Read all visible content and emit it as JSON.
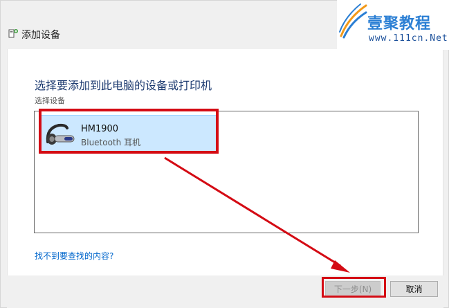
{
  "window": {
    "title": "添加设备",
    "title_icon": "add-device-icon"
  },
  "watermark": {
    "brand_cn": "壹聚教程",
    "url": "www.111cn.Net"
  },
  "main": {
    "heading": "选择要添加到此电脑的设备或打印机",
    "sublabel": "选择设备",
    "devices": [
      {
        "name": "HM1900",
        "type": "Bluetooth 耳机",
        "icon": "bluetooth-headset-icon",
        "selected": true
      }
    ],
    "help_link": "找不到要查找的内容?"
  },
  "footer": {
    "next_label": "下一步(N)",
    "next_enabled": false,
    "cancel_label": "取消"
  },
  "colors": {
    "annotation_red": "#d40b14",
    "selection_bg": "#cce8ff",
    "link_blue": "#0066cc"
  }
}
